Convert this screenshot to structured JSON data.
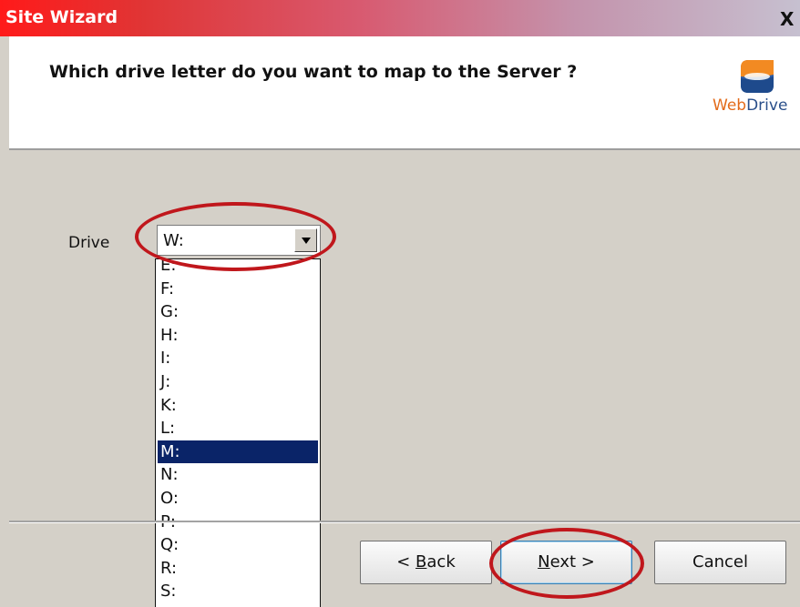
{
  "window": {
    "title": "Site Wizard",
    "close_glyph": "X"
  },
  "header": {
    "question": "Which drive letter do you want to map to the Server ?",
    "brand_part1": "Web",
    "brand_part2": "Drive",
    "logo_icon": "webdrive-logo-icon"
  },
  "form": {
    "drive_label": "Drive",
    "drive_value": "W:",
    "dropdown_icon": "chevron-down-icon"
  },
  "dropdown": {
    "items": [
      "E:",
      "F:",
      "G:",
      "H:",
      "I:",
      "J:",
      "K:",
      "L:",
      "M:",
      "N:",
      "O:",
      "P:",
      "Q:",
      "R:",
      "S:"
    ],
    "highlighted": "M:"
  },
  "buttons": {
    "back_mnemonic": "B",
    "back_rest": "ack",
    "back_prefix": "< ",
    "next_mnemonic": "N",
    "next_rest": "ext >",
    "cancel": "Cancel"
  },
  "annotation": {
    "highlight_color": "#c0171c"
  }
}
